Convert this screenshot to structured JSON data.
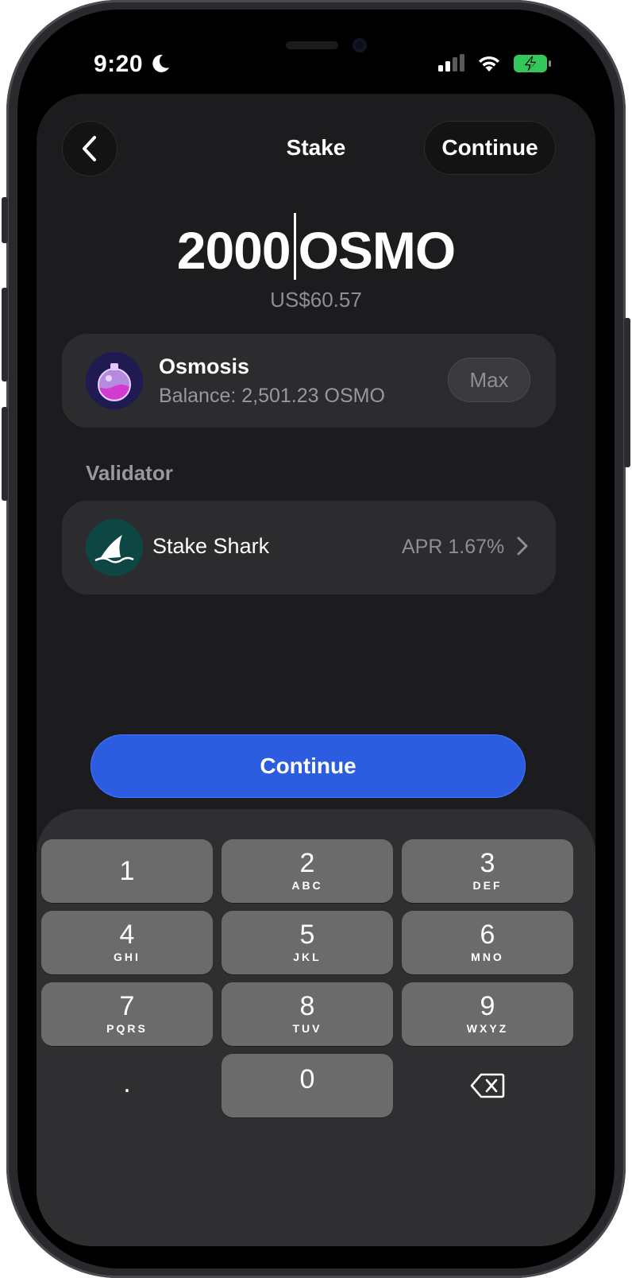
{
  "status_bar": {
    "time": "9:20",
    "icons": [
      "moon-icon",
      "cellular-signal-icon",
      "wifi-icon",
      "battery-charging-icon"
    ]
  },
  "header": {
    "title": "Stake",
    "continue_label": "Continue",
    "back_icon": "chevron-left-icon"
  },
  "amount": {
    "value": "2000",
    "unit": "OSMO",
    "fiat": "US$60.57"
  },
  "asset": {
    "name": "Osmosis",
    "balance": "Balance: 2,501.23 OSMO",
    "max_label": "Max",
    "icon": "osmosis-potion-icon"
  },
  "validator": {
    "section_label": "Validator",
    "name": "Stake Shark",
    "apr": "APR 1.67%",
    "icon": "shark-fin-icon"
  },
  "primary_button": {
    "label": "Continue"
  },
  "keypad": {
    "keys": [
      {
        "num": "1",
        "letters": ""
      },
      {
        "num": "2",
        "letters": "ABC"
      },
      {
        "num": "3",
        "letters": "DEF"
      },
      {
        "num": "4",
        "letters": "GHI"
      },
      {
        "num": "5",
        "letters": "JKL"
      },
      {
        "num": "6",
        "letters": "MNO"
      },
      {
        "num": "7",
        "letters": "PQRS"
      },
      {
        "num": "8",
        "letters": "TUV"
      },
      {
        "num": "9",
        "letters": "WXYZ"
      }
    ],
    "decimal": ".",
    "zero": "0",
    "delete_icon": "backspace-icon"
  },
  "colors": {
    "background": "#1c1c1e",
    "card": "#2c2c2e",
    "accent": "#2c5ce0",
    "key": "#6b6b6b",
    "battery_green": "#34c759"
  }
}
